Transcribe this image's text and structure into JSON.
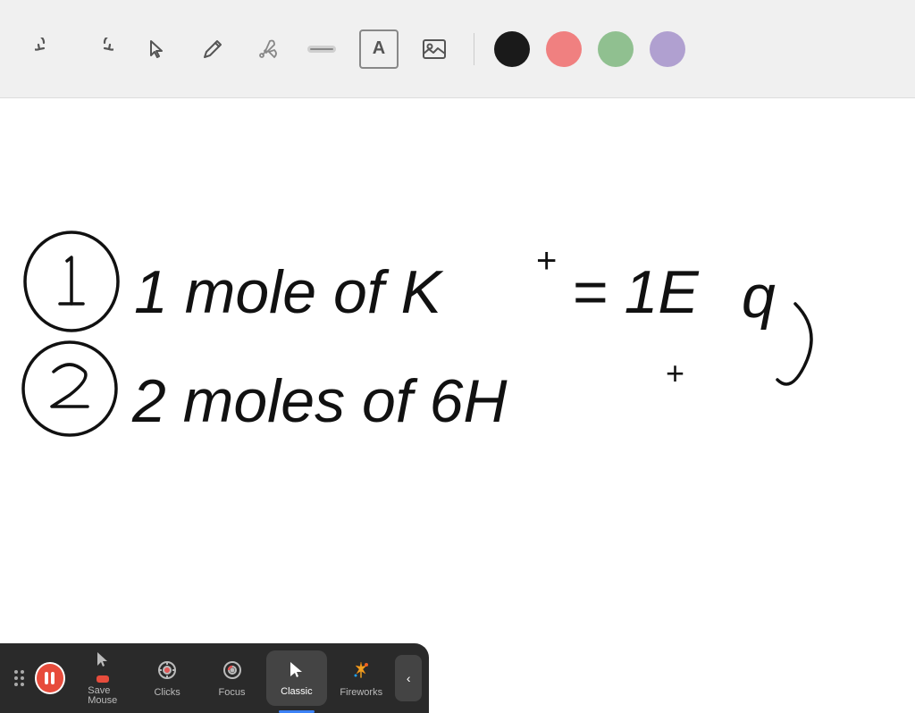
{
  "toolbar": {
    "tools": [
      {
        "name": "undo",
        "icon": "↺",
        "label": "Undo"
      },
      {
        "name": "redo",
        "icon": "↻",
        "label": "Redo"
      },
      {
        "name": "cursor",
        "icon": "↖",
        "label": "Cursor"
      },
      {
        "name": "pencil",
        "icon": "✏",
        "label": "Pencil"
      },
      {
        "name": "tools",
        "icon": "⚙",
        "label": "Tools"
      },
      {
        "name": "highlight",
        "icon": "▱",
        "label": "Highlight"
      },
      {
        "name": "text",
        "icon": "A",
        "label": "Text"
      },
      {
        "name": "image",
        "icon": "🖼",
        "label": "Image"
      }
    ],
    "colors": [
      {
        "name": "black",
        "value": "#1a1a1a"
      },
      {
        "name": "pink",
        "value": "#f08080"
      },
      {
        "name": "green",
        "value": "#90c090"
      },
      {
        "name": "purple",
        "value": "#b0a0d0"
      }
    ]
  },
  "canvas": {
    "background": "#ffffff"
  },
  "bottom_bar": {
    "items": [
      {
        "id": "save-mouse",
        "label": "Save\nMouse",
        "active": false
      },
      {
        "id": "clicks",
        "label": "Clicks",
        "active": false
      },
      {
        "id": "focus",
        "label": "Focus",
        "active": false
      },
      {
        "id": "classic",
        "label": "Classic",
        "active": true
      },
      {
        "id": "fireworks",
        "label": "Fireworks",
        "active": false
      }
    ],
    "chevron": "<"
  }
}
